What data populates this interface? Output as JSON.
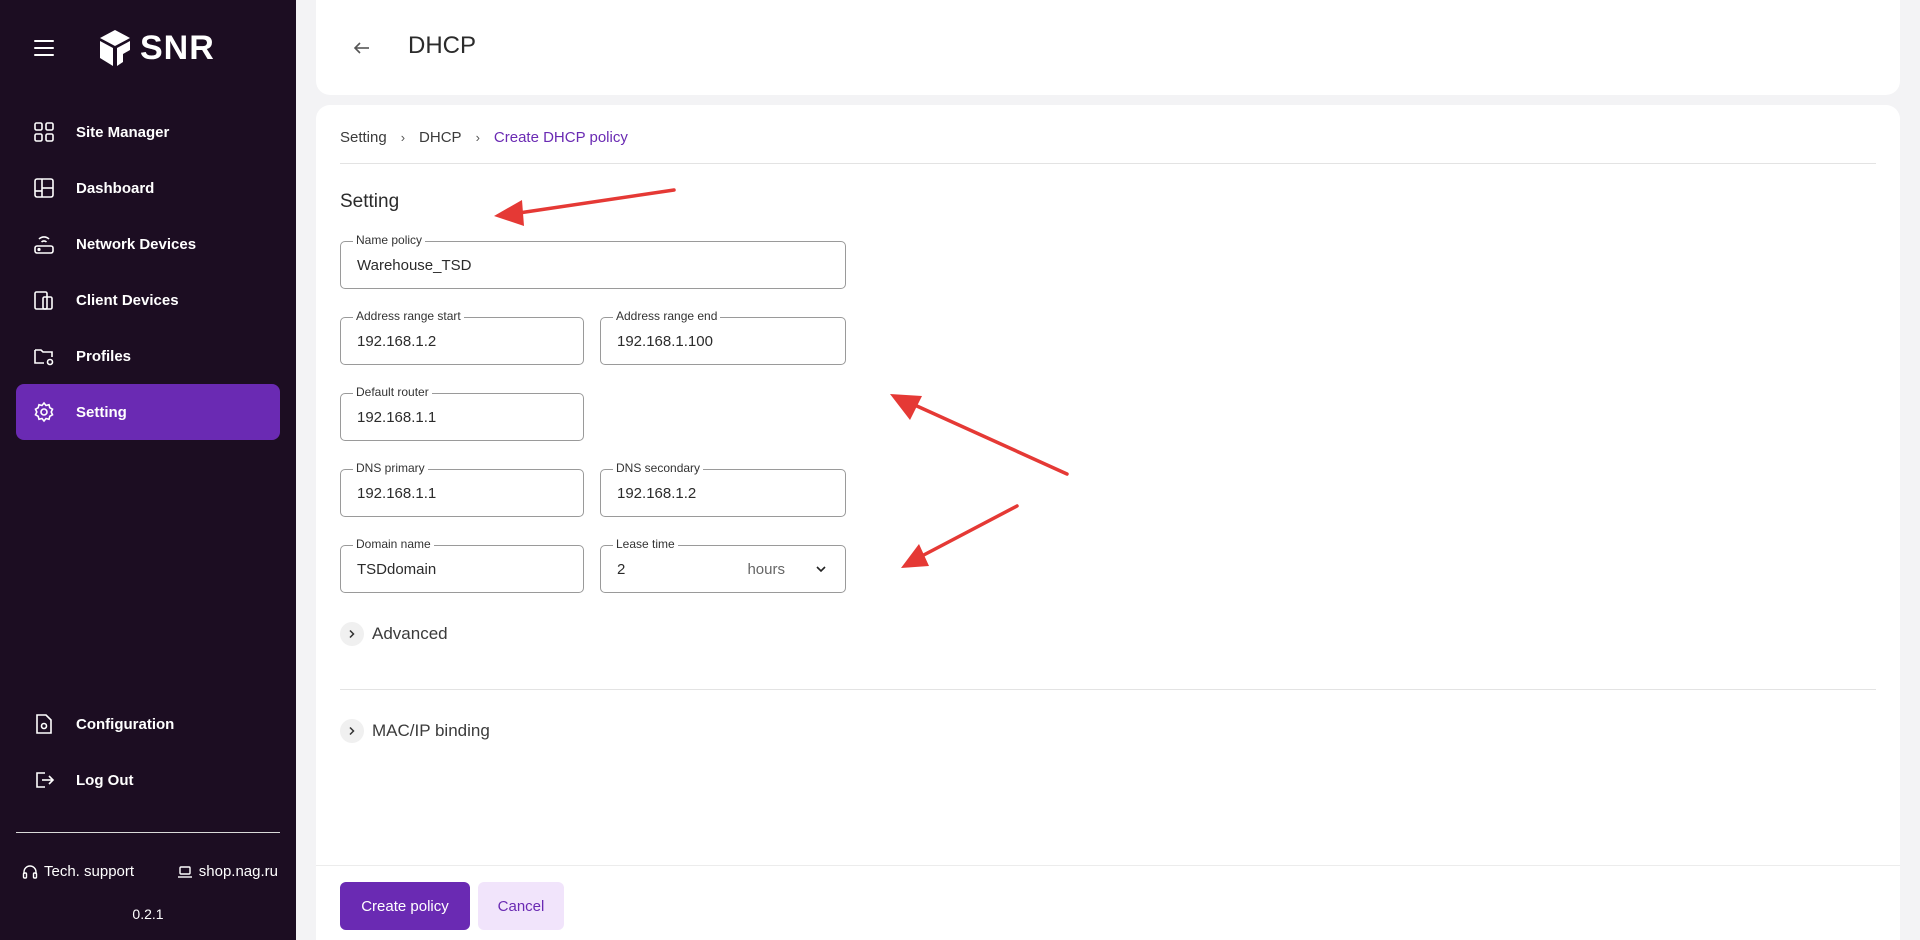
{
  "app": {
    "logo_text": "SNR",
    "version": "0.2.1"
  },
  "sidebar": {
    "items": [
      {
        "label": "Site Manager",
        "icon": "grid-icon",
        "active": false
      },
      {
        "label": "Dashboard",
        "icon": "dashboard-icon",
        "active": false
      },
      {
        "label": "Network Devices",
        "icon": "router-icon",
        "active": false
      },
      {
        "label": "Client Devices",
        "icon": "devices-icon",
        "active": false
      },
      {
        "label": "Profiles",
        "icon": "folder-gear-icon",
        "active": false
      },
      {
        "label": "Setting",
        "icon": "gear-icon",
        "active": true
      }
    ],
    "bottom_items": [
      {
        "label": "Configuration",
        "icon": "file-gear-icon"
      },
      {
        "label": "Log Out",
        "icon": "logout-icon"
      }
    ],
    "links": {
      "support": "Tech. support",
      "shop": "shop.nag.ru"
    }
  },
  "header": {
    "title": "DHCP"
  },
  "breadcrumb": [
    "Setting",
    "DHCP",
    "Create DHCP policy"
  ],
  "form": {
    "section_title": "Setting",
    "name_policy": {
      "label": "Name policy",
      "value": "Warehouse_TSD"
    },
    "range_start": {
      "label": "Address range start",
      "value": "192.168.1.2"
    },
    "range_end": {
      "label": "Address range end",
      "value": "192.168.1.100"
    },
    "default_router": {
      "label": "Default router",
      "value": "192.168.1.1"
    },
    "dns_primary": {
      "label": "DNS primary",
      "value": "192.168.1.1"
    },
    "dns_secondary": {
      "label": "DNS secondary",
      "value": "192.168.1.2"
    },
    "domain_name": {
      "label": "Domain name",
      "value": "TSDdomain"
    },
    "lease_time": {
      "label": "Lease time",
      "value": "2",
      "unit": "hours"
    },
    "advanced_label": "Advanced",
    "mac_ip_label": "MAC/IP binding"
  },
  "footer": {
    "create_label": "Create policy",
    "cancel_label": "Cancel"
  },
  "colors": {
    "sidebar_bg": "#1c0d22",
    "accent": "#6a2ab3",
    "annotation_arrow": "#e53935"
  }
}
